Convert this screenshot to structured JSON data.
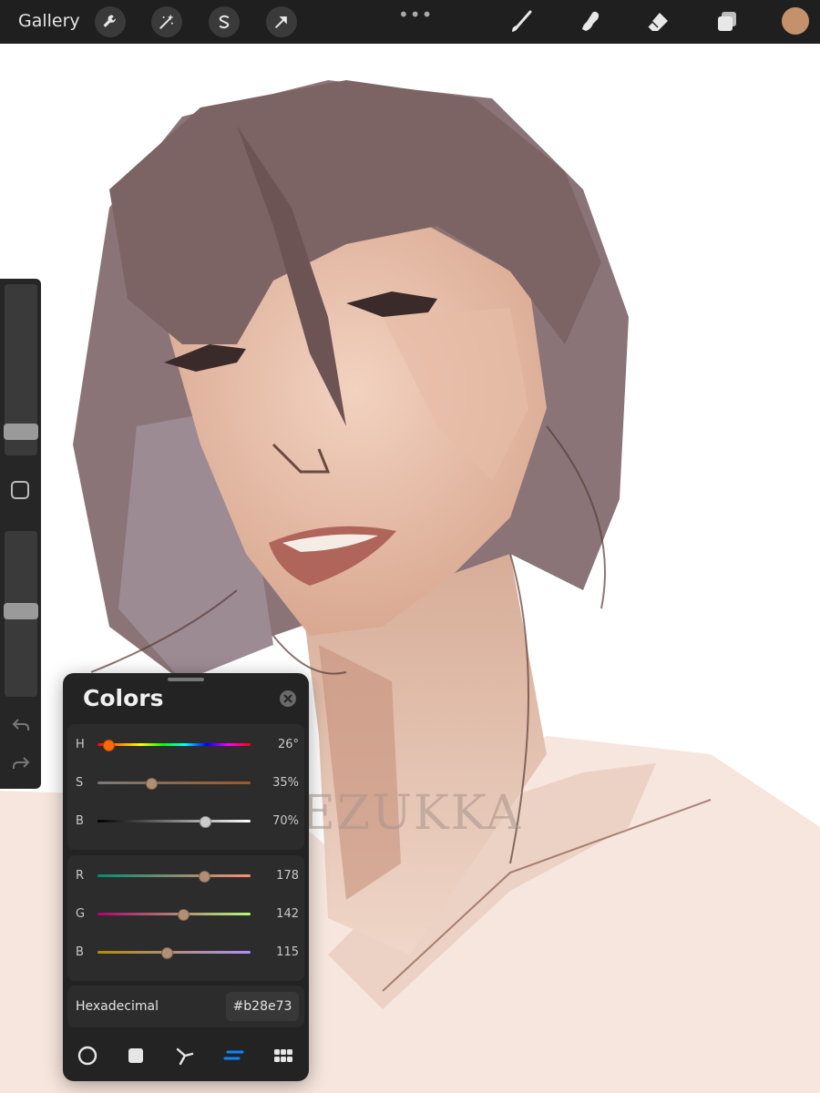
{
  "toolbar": {
    "gallery_label": "Gallery",
    "more_label": "•••",
    "current_color": "#c4916b"
  },
  "canvas": {
    "watermark": "EZUKKA"
  },
  "colors_panel": {
    "title": "Colors",
    "hsb": [
      {
        "label": "H",
        "value": "26°",
        "level": 0.072
      },
      {
        "label": "S",
        "value": "35%",
        "level": 0.35
      },
      {
        "label": "B",
        "value": "70%",
        "level": 0.7
      }
    ],
    "rgb": [
      {
        "label": "R",
        "value": "178",
        "level": 0.698
      },
      {
        "label": "G",
        "value": "142",
        "level": 0.557
      },
      {
        "label": "B",
        "value": "115",
        "level": 0.451
      }
    ],
    "hex_label": "Hexadecimal",
    "hex_value": "#b28e73",
    "active_mode": "palettes-sliders"
  },
  "sidebar": {
    "brush_size_level": 0.9,
    "opacity_level": 0.48
  }
}
